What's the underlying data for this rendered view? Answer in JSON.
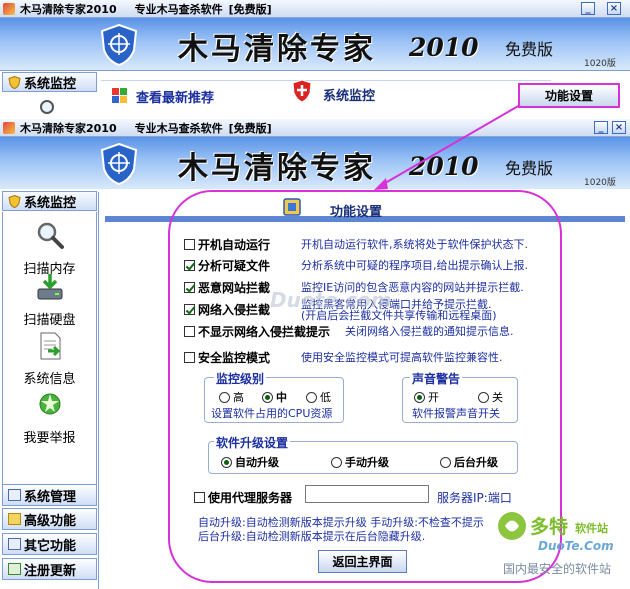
{
  "window_top": {
    "title": "木马清除专家2010",
    "subtitle": "专业木马查杀软件",
    "edition_tag": "[免费版]"
  },
  "window_front": {
    "title": "木马清除专家2010",
    "subtitle": "专业木马查杀软件",
    "edition_tag": "[免费版]"
  },
  "banner": {
    "product_name": "木马清除专家",
    "year": "2010",
    "edition": "免费版",
    "build": "1020版"
  },
  "top_window_toolbar": {
    "sidebar_heading": "系统监控",
    "recommend_link": "查看最新推荐",
    "system_monitor": "系统监控",
    "function_settings_button": "功能设置"
  },
  "sidebar": {
    "heading": "系统监控",
    "items": [
      {
        "label": "扫描内存",
        "icon": "magnifier-icon"
      },
      {
        "label": "扫描硬盘",
        "icon": "disk-download-icon"
      },
      {
        "label": "系统信息",
        "icon": "document-arrow-icon"
      },
      {
        "label": "我要举报",
        "icon": "alert-star-icon"
      }
    ],
    "nav": [
      {
        "label": "系统管理"
      },
      {
        "label": "高级功能"
      },
      {
        "label": "其它功能"
      },
      {
        "label": "注册更新"
      }
    ]
  },
  "panel": {
    "title": "功能设置",
    "options": [
      {
        "label": "开机自动运行",
        "checked": false,
        "desc": "开机自动运行软件,系统将处于软件保护状态下."
      },
      {
        "label": "分析可疑文件",
        "checked": true,
        "desc": "分析系统中可疑的程序项目,给出提示确认上报."
      },
      {
        "label": "恶意网站拦截",
        "checked": true,
        "desc": "监控IE访问的包含恶意内容的网站并提示拦截."
      },
      {
        "label": "网络入侵拦截",
        "checked": true,
        "desc": "监控黑客常用入侵端口并给予提示拦截.",
        "desc2": "(开启后会拦截文件共享传输和远程桌面)"
      },
      {
        "label": "不显示网络入侵拦截提示",
        "checked": false,
        "desc": "关闭网络入侵拦截的通知提示信息."
      },
      {
        "label": "安全监控模式",
        "checked": false,
        "desc": "使用安全监控模式可提高软件监控兼容性."
      }
    ],
    "monitor_level": {
      "title": "监控级别",
      "options": [
        "高",
        "中",
        "低"
      ],
      "selected": "中",
      "desc": "设置软件占用的CPU资源"
    },
    "sound_alert": {
      "title": "声音警告",
      "options": [
        "开",
        "关"
      ],
      "selected": "开",
      "desc": "软件报警声音开关"
    },
    "upgrade": {
      "title": "软件升级设置",
      "options": [
        "自动升级",
        "手动升级",
        "后台升级"
      ],
      "selected": "自动升级"
    },
    "proxy": {
      "label": "使用代理服务器",
      "checked": false,
      "server_label": "服务器IP:端口",
      "value": ""
    },
    "notes": [
      "自动升级:自动检测新版本提示升级   手动升级:不检查不提示",
      "后台升级:自动检测新版本提示在后台隐藏升级."
    ],
    "return_button": "返回主界面"
  },
  "watermarks": {
    "center": "Duote.com",
    "logo_text": "多特",
    "logo_sub": "软件站",
    "logo_domain": "DuoTe.Com",
    "tagline": "国内最安全的软件站"
  },
  "colors": {
    "accent": "#1c2fa0",
    "annotation": "#d632d8",
    "banner_top": "#5a93e6",
    "watermark": "#7dbd2c"
  }
}
